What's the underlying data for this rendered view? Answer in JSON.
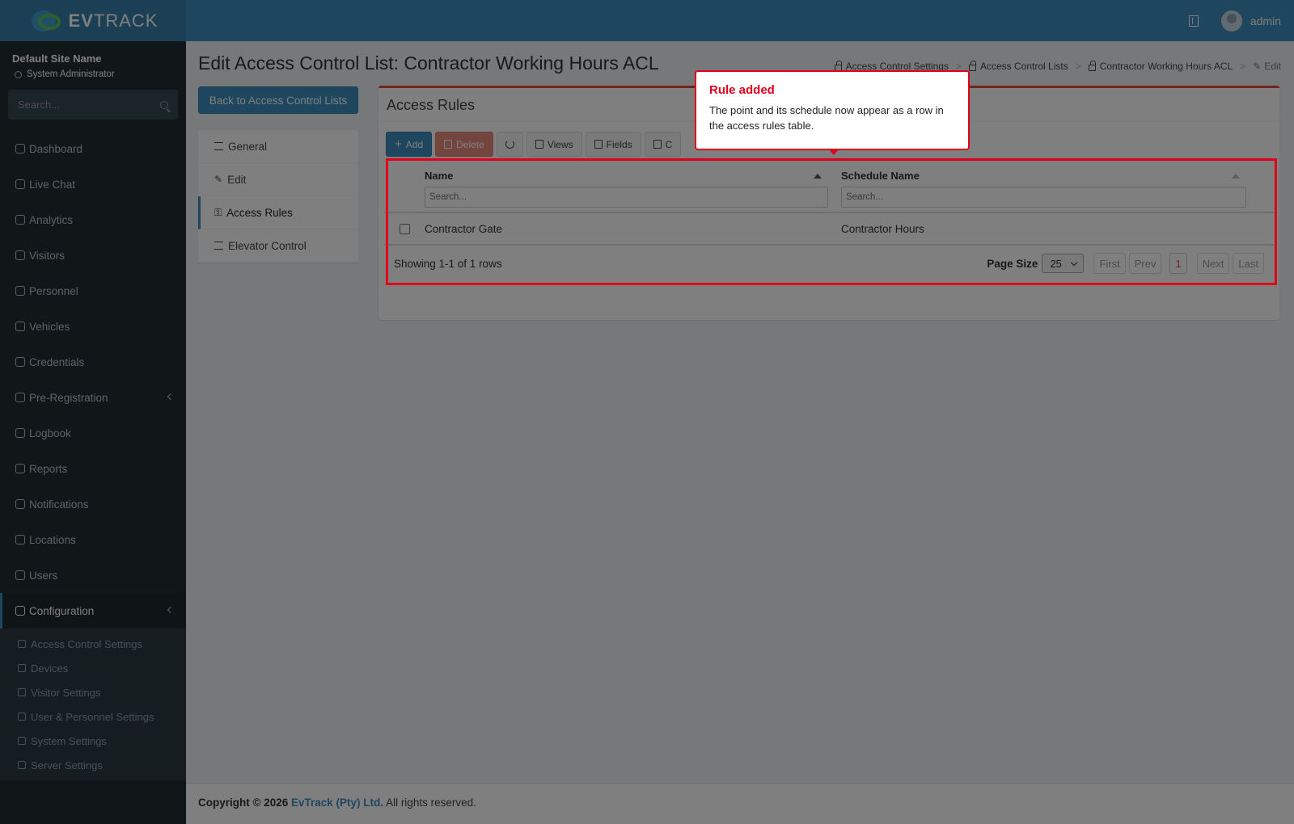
{
  "header": {
    "logo_bold": "EV",
    "logo_rest": "TRACK",
    "username": "admin"
  },
  "sidebar": {
    "site_name": "Default Site Name",
    "role": "System Administrator",
    "search_placeholder": "Search...",
    "items": [
      {
        "label": "Dashboard",
        "icon": "dashboard-icon"
      },
      {
        "label": "Live Chat",
        "icon": "headset-icon"
      },
      {
        "label": "Analytics",
        "icon": "analytics-icon"
      },
      {
        "label": "Visitors",
        "icon": "eye-icon"
      },
      {
        "label": "Personnel",
        "icon": "personnel-icon"
      },
      {
        "label": "Vehicles",
        "icon": "car-icon"
      },
      {
        "label": "Credentials",
        "icon": "id-card-icon"
      },
      {
        "label": "Pre-Registration",
        "icon": "arrows-icon"
      },
      {
        "label": "Logbook",
        "icon": "book-icon"
      },
      {
        "label": "Reports",
        "icon": "chart-icon"
      },
      {
        "label": "Notifications",
        "icon": "chat-icon"
      },
      {
        "label": "Locations",
        "icon": "building-icon"
      },
      {
        "label": "Users",
        "icon": "users-icon"
      },
      {
        "label": "Configuration",
        "icon": "gear-icon"
      }
    ],
    "submenu": [
      {
        "label": "Access Control Settings",
        "icon": "lock-icon"
      },
      {
        "label": "Devices",
        "icon": "device-icon"
      },
      {
        "label": "Visitor Settings",
        "icon": "eye-icon"
      },
      {
        "label": "User & Personnel Settings",
        "icon": "users-icon"
      },
      {
        "label": "System Settings",
        "icon": "sliders-icon"
      },
      {
        "label": "Server Settings",
        "icon": "server-icon"
      }
    ]
  },
  "page": {
    "title": "Edit Access Control List: Contractor Working Hours ACL",
    "breadcrumb": [
      "Access Control Settings",
      "Access Control Lists",
      "Contractor Working Hours ACL",
      "Edit"
    ],
    "back_button": "Back to Access Control Lists"
  },
  "nav": [
    "General",
    "Edit",
    "Access Rules",
    "Elevator Control"
  ],
  "box": {
    "title": "Access Rules",
    "toolbar": {
      "add": "Add",
      "delete": "Delete",
      "views": "Views",
      "fields": "Fields",
      "columns": "C"
    }
  },
  "grid": {
    "columns": [
      "Name",
      "Schedule Name"
    ],
    "filter_placeholder": "Search...",
    "rows": [
      {
        "name": "Contractor Gate",
        "schedule": "Contractor Hours"
      }
    ],
    "summary": "Showing 1-1 of 1 rows",
    "page_size_label": "Page Size",
    "page_size": "25",
    "pager": {
      "first": "First",
      "prev": "Prev",
      "current": "1",
      "next": "Next",
      "last": "Last"
    }
  },
  "tooltip": {
    "title": "Rule added",
    "body": "The point and its schedule now appear as a row in the access rules table."
  },
  "footer": {
    "prefix": "Copyright © 2026",
    "brand": "EvTrack (Pty) Ltd.",
    "suffix": "All rights reserved."
  },
  "colors": {
    "primary": "#3c8dbc",
    "danger": "#dd4b39",
    "highlight": "#e0001b",
    "sidebar": "#222d32"
  }
}
